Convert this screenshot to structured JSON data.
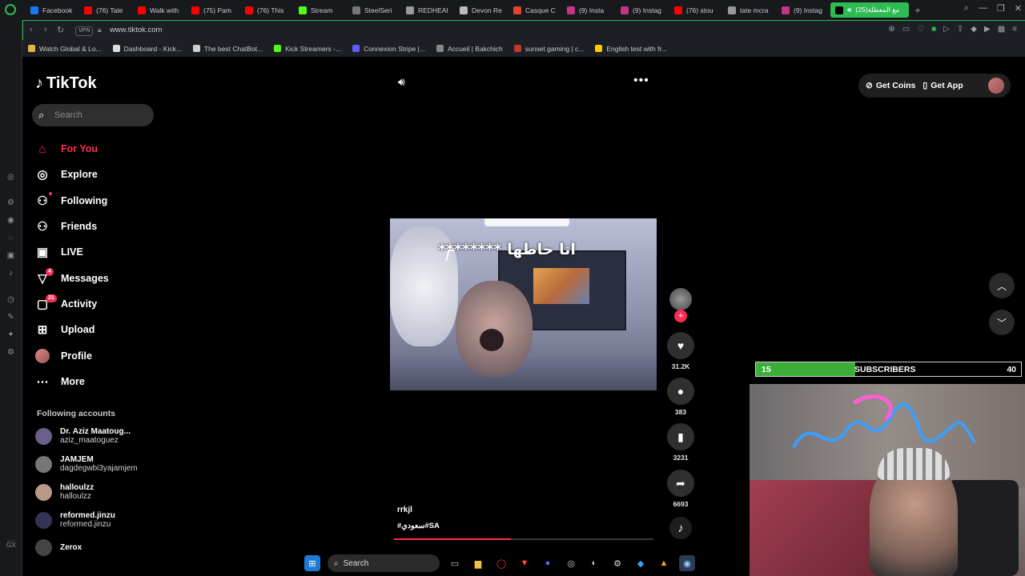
{
  "browser": {
    "tabs": [
      {
        "label": "Facebook",
        "color": "#1877f2"
      },
      {
        "label": "(76) Tate",
        "color": "#ff0000"
      },
      {
        "label": "Walk with",
        "color": "#ff0000"
      },
      {
        "label": "(75) Pam",
        "color": "#ff0000"
      },
      {
        "label": "(76) This",
        "color": "#ff0000"
      },
      {
        "label": "Stream",
        "color": "#53fc18"
      },
      {
        "label": "SteelSeri",
        "color": "#777777"
      },
      {
        "label": "REDHEAI",
        "color": "#999999"
      },
      {
        "label": "Devon Re",
        "color": "#bbbbbb"
      },
      {
        "label": "Casque C",
        "color": "#e0442c"
      },
      {
        "label": "(9) Insta",
        "color": "#c13584"
      },
      {
        "label": "(9) Instag",
        "color": "#c13584"
      },
      {
        "label": "(76) stou",
        "color": "#ff0000"
      },
      {
        "label": "tate mcra",
        "color": "#999999"
      },
      {
        "label": "(9) Instag",
        "color": "#c13584"
      }
    ],
    "active_tab": {
      "label": "(25)مع المعطلة"
    },
    "vpn_label": "VPN",
    "url": "www.tiktok.com",
    "bookmarks": [
      {
        "label": "Watch Global & Lo...",
        "color": "#e0b84a"
      },
      {
        "label": "Dashboard - Kick...",
        "color": "#dddddd"
      },
      {
        "label": "The best ChatBot...",
        "color": "#cccccc"
      },
      {
        "label": "Kick Streamers -...",
        "color": "#53fc18"
      },
      {
        "label": "Connexion Stripe |...",
        "color": "#635bff"
      },
      {
        "label": "Accueil | Bakchich",
        "color": "#888888"
      },
      {
        "label": "sunset gaming | c...",
        "color": "#c0392b"
      },
      {
        "label": "English test with fr...",
        "color": "#ffcc00"
      }
    ],
    "gx_label": "GX"
  },
  "tiktok": {
    "logo": "TikTok",
    "search_placeholder": "Search",
    "nav": [
      {
        "label": "For You",
        "icon": "home-icon"
      },
      {
        "label": "Explore",
        "icon": "compass-icon"
      },
      {
        "label": "Following",
        "icon": "following-icon"
      },
      {
        "label": "Friends",
        "icon": "friends-icon"
      },
      {
        "label": "LIVE",
        "icon": "live-icon"
      },
      {
        "label": "Messages",
        "icon": "messages-icon",
        "badge": "4"
      },
      {
        "label": "Activity",
        "icon": "activity-icon",
        "badge": "21"
      },
      {
        "label": "Upload",
        "icon": "upload-icon"
      },
      {
        "label": "Profile",
        "icon": "profile-avatar"
      },
      {
        "label": "More",
        "icon": "more-icon"
      }
    ],
    "following_heading": "Following accounts",
    "following": [
      {
        "name": "Dr. Aziz Maatoug...",
        "handle": "aziz_maatoguez"
      },
      {
        "name": "JAMJEM",
        "handle": "dagdegwbi3yajamjem"
      },
      {
        "name": "halloulzz",
        "handle": "halloulzz"
      },
      {
        "name": "reformed.jinzu",
        "handle": "reformed.jinzu"
      },
      {
        "name": "Zerox",
        "handle": ""
      }
    ],
    "get_coins": "Get Coins",
    "get_app": "Get App",
    "video": {
      "caption": "انا حاطها ********",
      "author": "rrkjl",
      "hashtags": "#سعودي#SA",
      "progress": 0.45
    },
    "actions": {
      "likes": "31.2K",
      "comments": "383",
      "saves": "3231",
      "shares": "6693"
    }
  },
  "overlay": {
    "subs_current": "15",
    "subs_label": "SUBSCRIBERS",
    "subs_goal": "40",
    "subs_fraction": 0.375
  },
  "taskbar": {
    "search_label": "Search"
  }
}
